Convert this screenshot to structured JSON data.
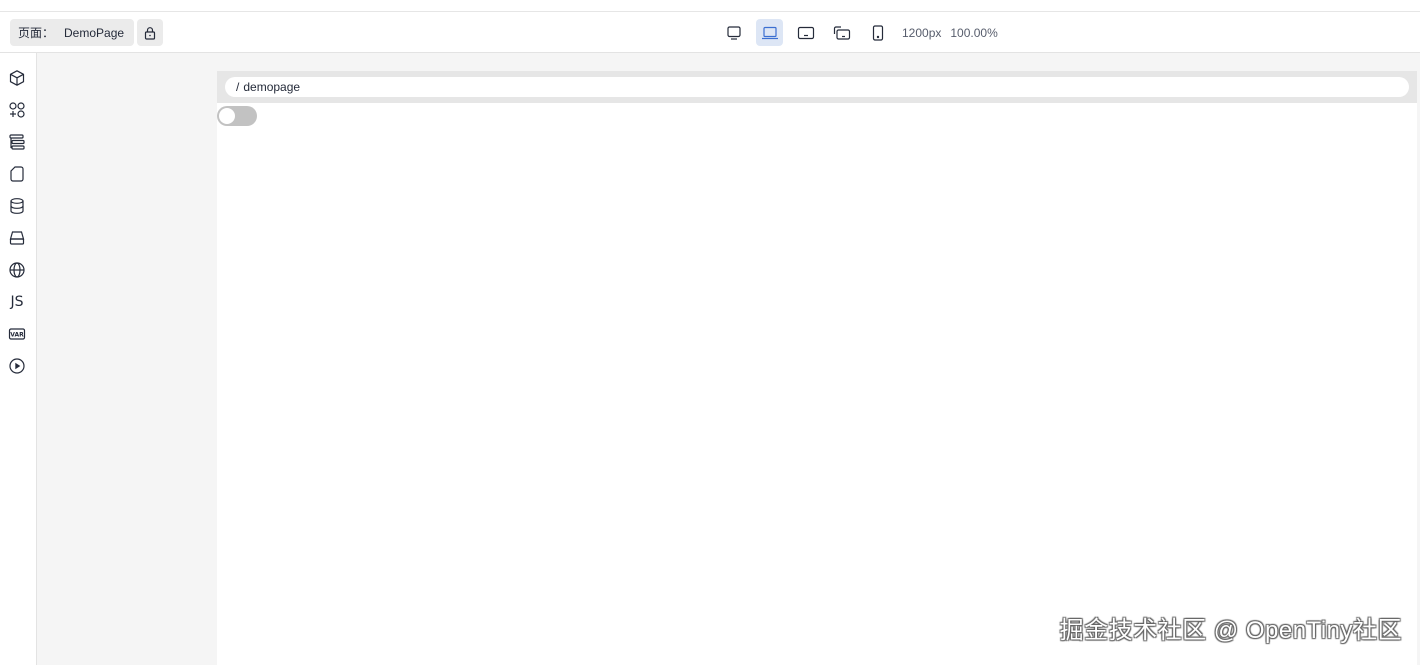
{
  "toolbar": {
    "page_label": "页面：",
    "page_name": "DemoPage",
    "width_readout": "1200px",
    "zoom_readout": "100.00%",
    "lock_icon": "lock-icon",
    "devices": [
      "desktop-icon",
      "laptop-icon",
      "tablet-landscape-icon",
      "tablet-rotate-icon",
      "phone-icon"
    ],
    "active_device": "laptop-icon"
  },
  "sidebar": {
    "items": [
      {
        "icon": "component-cube-icon"
      },
      {
        "icon": "add-component-icon"
      },
      {
        "icon": "outline-tree-icon"
      },
      {
        "icon": "page-file-icon"
      },
      {
        "icon": "database-icon"
      },
      {
        "icon": "block-storage-icon"
      },
      {
        "icon": "globe-i18n-icon"
      },
      {
        "icon": "js-code-icon",
        "label": "JS"
      },
      {
        "icon": "var-icon",
        "label": "VAR"
      },
      {
        "icon": "play-preview-icon"
      }
    ]
  },
  "canvas": {
    "breadcrumb_sep": "/",
    "breadcrumb_text": "demopage",
    "switch_on": false
  },
  "watermark": "掘金技术社区 @ OpenTiny社区",
  "colors": {
    "accent": "#5e7ce0",
    "active_bg": "#dde6f5",
    "canvas_bg": "#f5f5f5"
  }
}
